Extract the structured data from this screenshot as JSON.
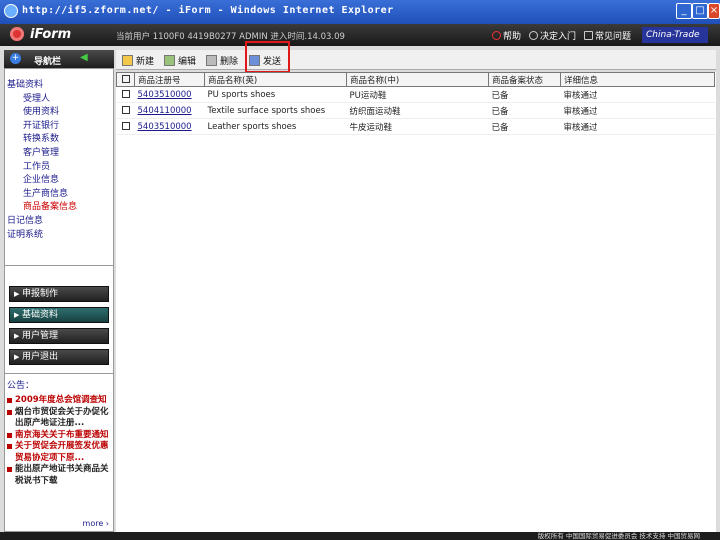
{
  "window": {
    "title": "http://if5.zform.net/ - iForm - Windows Internet Explorer"
  },
  "header": {
    "logo": "iForm",
    "user_info": "当前用户 1100F0  4419B0277  ADMIN   进入时间.14.03.09",
    "links": [
      "帮助",
      "决定入门",
      "常见问题"
    ],
    "brand": "China-Trade"
  },
  "sidebar": {
    "head_label": "导航栏",
    "tree": [
      {
        "label": "基础资料",
        "level": 0
      },
      {
        "label": "受理人",
        "level": 1
      },
      {
        "label": "使用资料",
        "level": 1
      },
      {
        "label": "开证银行",
        "level": 1
      },
      {
        "label": "转换系数",
        "level": 1
      },
      {
        "label": "客户管理",
        "level": 1
      },
      {
        "label": "工作员",
        "level": 1
      },
      {
        "label": "企业信息",
        "level": 1
      },
      {
        "label": "生产商信息",
        "level": 1
      },
      {
        "label": "商品备案信息",
        "level": 1,
        "active": true
      },
      {
        "label": "日记信息",
        "level": 0
      },
      {
        "label": "证明系统",
        "level": 0
      }
    ],
    "nav_buttons": [
      {
        "label": "申报制作",
        "selected": false
      },
      {
        "label": "基础资料",
        "selected": true
      },
      {
        "label": "用户管理",
        "selected": false
      },
      {
        "label": "用户退出",
        "selected": false
      }
    ],
    "notice_title": "公告：",
    "notices": [
      {
        "text": "2009年度总会馆调查知",
        "dark": false
      },
      {
        "text": "烟台市贸促会关于办促化出原产地证注册...",
        "dark": true
      },
      {
        "text": "南京海关关于布重要通知",
        "dark": false
      },
      {
        "text": "关于贸促会开展签发优惠贸易协定项下原...",
        "dark": false
      },
      {
        "text": "能出原产地证书关商品关税说书下载",
        "dark": true
      }
    ],
    "more_label": "more ›"
  },
  "toolbar": {
    "buttons": [
      "新建",
      "编辑",
      "删除",
      "发送"
    ]
  },
  "table": {
    "headers": [
      "商品注册号",
      "商品名称(英)",
      "商品名称(中)",
      "商品备案状态",
      "详细信息"
    ],
    "rows": [
      [
        "5403510000",
        "PU sports shoes",
        "PU运动鞋",
        "已备",
        "审核通过"
      ],
      [
        "5404110000",
        "Textile surface sports shoes",
        "纺织面运动鞋",
        "已备",
        "审核通过"
      ],
      [
        "5403510000",
        "Leather sports shoes",
        "牛皮运动鞋",
        "已备",
        "审核通过"
      ]
    ]
  },
  "status": {
    "text": "版权所有 中国国际贸易促进委员会 技术支持 中国贸易网"
  }
}
